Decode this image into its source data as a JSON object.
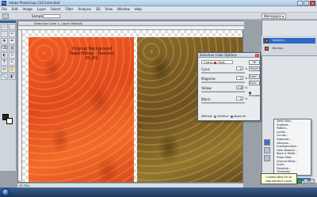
{
  "window": {
    "title": "Adobe Photoshop CS4 Extended",
    "app_logo": "Ps",
    "controls": [
      "–",
      "▢",
      "✕"
    ]
  },
  "menubar": [
    "File",
    "Edit",
    "Image",
    "Layer",
    "Select",
    "Filter",
    "Analysis",
    "3D",
    "View",
    "Window",
    "Help"
  ],
  "options_bar": {
    "label": "Sample Size:",
    "workspace": "Workspace ▾"
  },
  "tools": [
    "▭",
    "⬚",
    "◌",
    "✂",
    "✥",
    "✒",
    "⌫",
    "▨",
    "◐",
    "☼",
    "T",
    "↖",
    "⬭",
    "✋",
    "🔍",
    "◧"
  ],
  "document": {
    "tab_title": "Selective Color 1, Layer Mask/8)",
    "status": "33.33%"
  },
  "canvas": {
    "label_original": "Original Background Paper/Wisey - Damask 05.JPG"
  },
  "selective_color": {
    "title": "Selective Color Options",
    "close": "x",
    "colors_label": "Colors:",
    "colors_value": "Reds",
    "sliders": [
      {
        "label": "Cyan:",
        "value": "0"
      },
      {
        "label": "Magenta:",
        "value": "0"
      },
      {
        "label": "Yellow:",
        "value": "+18"
      },
      {
        "label": "Black:",
        "value": "0"
      }
    ],
    "pct": "%",
    "buttons": [
      "OK",
      "Reset",
      "Load...",
      "Save..."
    ],
    "preview_label": "Preview",
    "method_label": "Method:",
    "relative_label": "Relative",
    "absolute_label": "Absolute"
  },
  "layers": {
    "items": [
      {
        "name": "Selectiv..."
      },
      {
        "name": "Backgr..."
      }
    ]
  },
  "adjustments_menu": {
    "items": [
      "Solid Color...",
      "Gradient...",
      "Pattern...",
      "Levels...",
      "Curves...",
      "Exposure...",
      "Vibrance...",
      "Hue/Saturation...",
      "Color Balance...",
      "Black & White...",
      "Photo Filter...",
      "Channel Mixer...",
      "Invert",
      "Posterize...",
      "Threshold...",
      "Gradient Map...",
      "Selective Color..."
    ],
    "selected": 16
  },
  "tooltip": {
    "text": "Create New Fill or Adjustment Layer"
  }
}
